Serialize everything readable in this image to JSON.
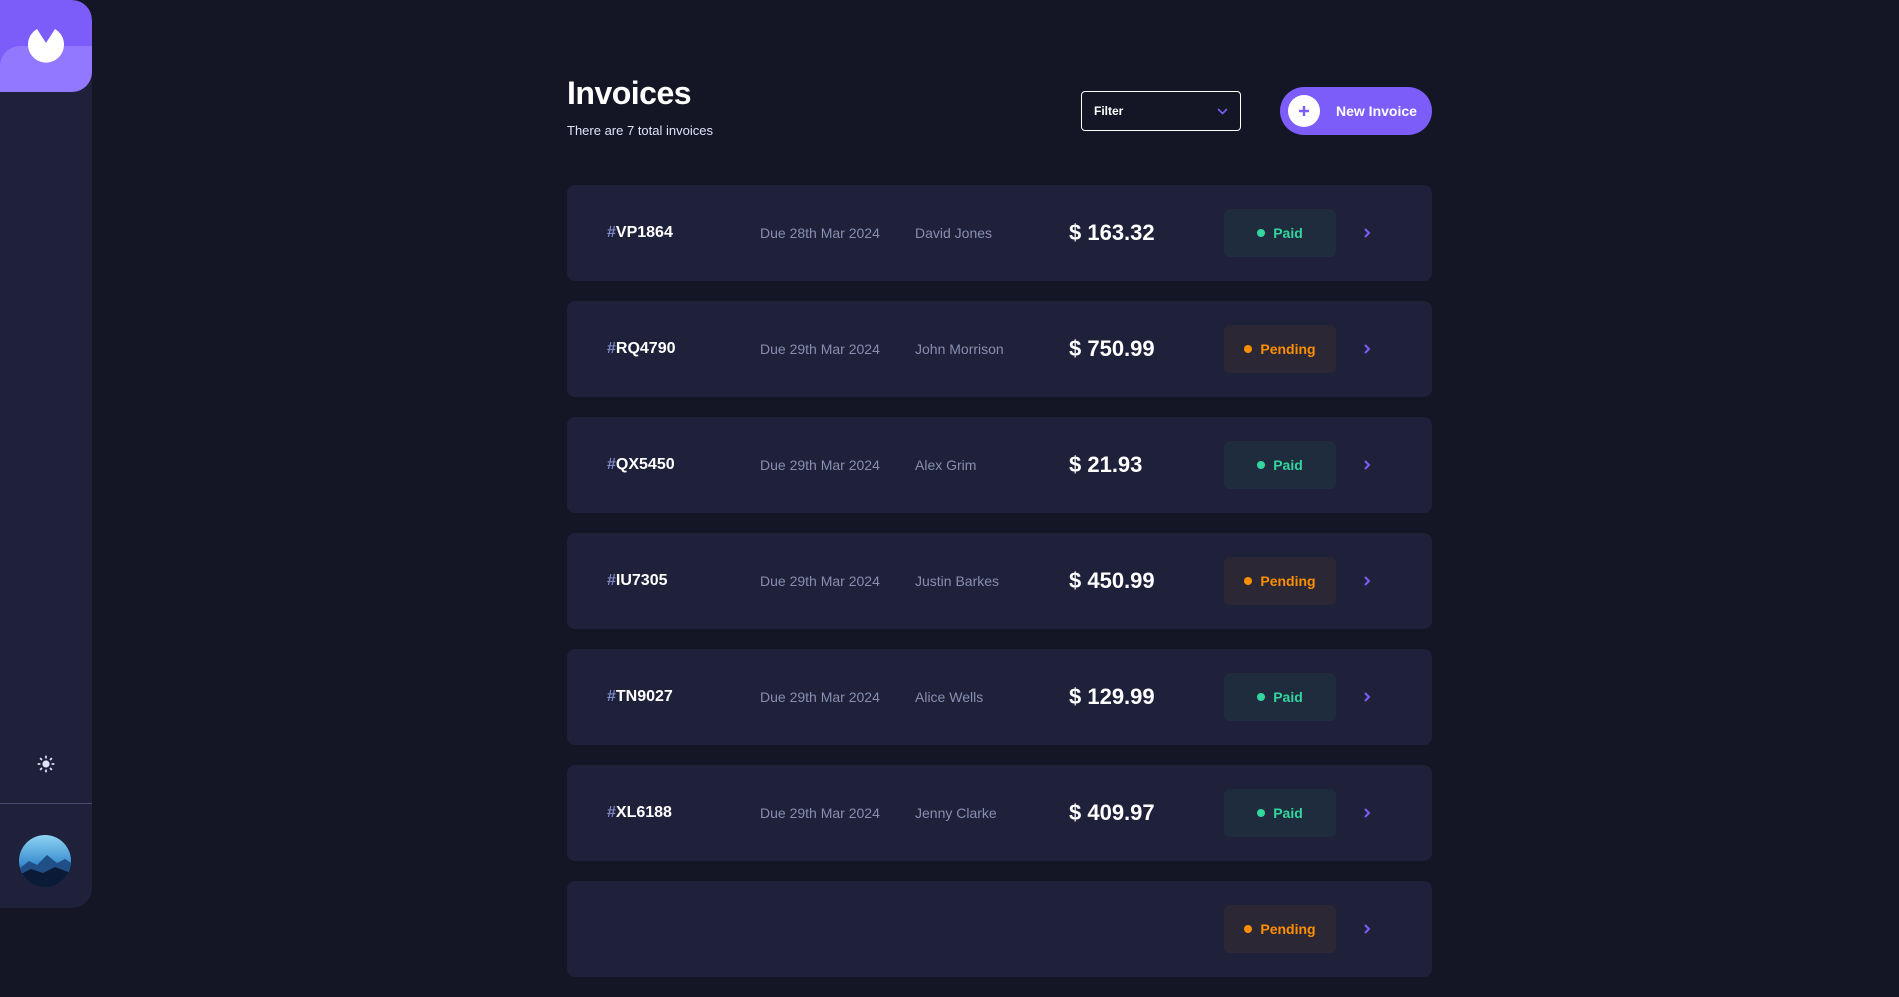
{
  "app": {
    "colors": {
      "accent": "#7c5dfa",
      "paid": "#33d69f",
      "pending": "#ff8f00",
      "background": "#141625",
      "card": "#1e2139"
    }
  },
  "sidebar": {
    "logo_icon": "logo-icon",
    "theme_icon": "sun-icon",
    "avatar_icon": "avatar-image"
  },
  "header": {
    "title": "Invoices",
    "subtitle": "There are 7 total invoices",
    "filter_label": "Filter",
    "new_invoice_label": "New Invoice"
  },
  "invoices": [
    {
      "hash": "#",
      "id": "VP1864",
      "due": "Due 28th Mar 2024",
      "client": "David Jones",
      "amount": "$ 163.32",
      "status": "Paid"
    },
    {
      "hash": "#",
      "id": "RQ4790",
      "due": "Due 29th Mar 2024",
      "client": "John Morrison",
      "amount": "$ 750.99",
      "status": "Pending"
    },
    {
      "hash": "#",
      "id": "QX5450",
      "due": "Due 29th Mar 2024",
      "client": "Alex Grim",
      "amount": "$ 21.93",
      "status": "Paid"
    },
    {
      "hash": "#",
      "id": "IU7305",
      "due": "Due 29th Mar 2024",
      "client": "Justin Barkes",
      "amount": "$ 450.99",
      "status": "Pending"
    },
    {
      "hash": "#",
      "id": "TN9027",
      "due": "Due 29th Mar 2024",
      "client": "Alice Wells",
      "amount": "$ 129.99",
      "status": "Paid"
    },
    {
      "hash": "#",
      "id": "XL6188",
      "due": "Due 29th Mar 2024",
      "client": "Jenny Clarke",
      "amount": "$ 409.97",
      "status": "Paid"
    },
    {
      "hash": "",
      "id": "",
      "due": "",
      "client": "",
      "amount": "",
      "status": "Pending"
    }
  ]
}
